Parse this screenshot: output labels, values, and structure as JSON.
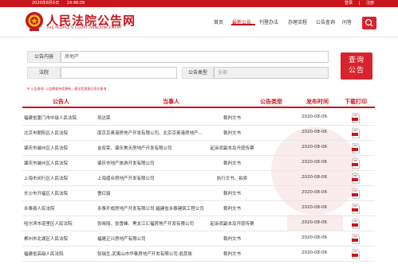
{
  "topbar": {
    "date": "2020年8月6日",
    "time": "14:48:09",
    "login": "登录",
    "register": "注册"
  },
  "logo": {
    "title": "人民法院公告网",
    "subtitle": "THE PEOPLE'S COURT ANNOUNCEMENT"
  },
  "nav": {
    "items": [
      "首页",
      "最新公告",
      "刊登办法",
      "办理流程",
      "公告查询",
      "问答"
    ],
    "active_index": 1
  },
  "search": {
    "announcer_label": "公告内容",
    "announcer_value": "房地产",
    "court_label": "法院",
    "court_value": "",
    "type_label": "公告类型",
    "type_value": "全部",
    "button": "查询\n公告",
    "note": "※ 公告查询: 公告数据持续更新，建议您满意后再次查询"
  },
  "table": {
    "headers": [
      "公告人",
      "当事人",
      "公告类型",
      "发布时间",
      "下载打印"
    ],
    "rows": [
      {
        "court": "福建省厦门市中级人民法院",
        "party": "吴达荣",
        "type": "裁判文书",
        "date": "2020-08-06"
      },
      {
        "court": "北京市朝阳区人民法院",
        "party": "南京京奥港房地产开发有限公司、北京京奥港房地产...",
        "type": "裁判文书",
        "date": "2020-08-06"
      },
      {
        "court": "肇庆市端州区人民法院",
        "party": "金双荣、肇庆美天房地产开发有限公司",
        "type": "起诉状副本及开庭传票",
        "date": "2020-08-06"
      },
      {
        "court": "肇庆市端州区人民法院",
        "party": "肇庆市地产旅游开发有限公司",
        "type": "裁判文书",
        "date": "2020-08-06"
      },
      {
        "court": "上海市闵行区人民法院",
        "party": "上海盛众房地产开发有限公司",
        "type": "执行文书、拍卖",
        "date": "2020-08-06"
      },
      {
        "court": "长沙市开福区人民法院",
        "party": "曹红骏",
        "type": "裁判文书",
        "date": "2020-08-06"
      },
      {
        "court": "永泰县人民法院",
        "party": "永泰开成房地产开发有限公司,福建省永泰建筑工程公司",
        "type": "裁判文书",
        "date": "2020-08-06"
      },
      {
        "court": "哈尔滨市道里区人民法院",
        "party": "张晓丽、张雪峰、黑龙江汇福房地产开发有限公司",
        "type": "起诉状副本及开庭传票",
        "date": "2020-08-06"
      },
      {
        "court": "郴州市北湖区人民法院",
        "party": "福建正兴房地产有限公司",
        "type": "裁判文书",
        "date": "2020-08-06"
      },
      {
        "court": "福建省高级人民法院",
        "party": "张瑞生,武夷山市华泰房地产开发有限公司,翁其俊",
        "type": "裁判文书",
        "date": "2020-08-06"
      }
    ]
  },
  "colors": {
    "brand": "#c8161d",
    "accent": "#d9232d"
  }
}
